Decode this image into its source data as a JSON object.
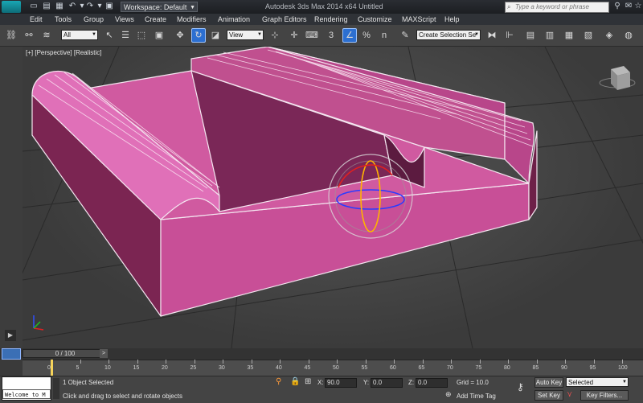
{
  "titlebar": {
    "workspace_label": "Workspace: Default",
    "window_title": "Autodesk 3ds Max  2014 x64   Untitled",
    "search_placeholder": "Type a keyword or phrase"
  },
  "menu": {
    "items": [
      "Edit",
      "Tools",
      "Group",
      "Views",
      "Create",
      "Modifiers",
      "Animation",
      "Graph Editors",
      "Rendering",
      "Customize",
      "MAXScript",
      "Help"
    ]
  },
  "toolbar": {
    "selection_filter": "All",
    "reference_coord": "View",
    "named_selection": "Create Selection Se",
    "snap_number": "3",
    "angle_snap_number": "n"
  },
  "viewport": {
    "label_plus": "[+]",
    "label_view": "[Perspective]",
    "label_shading": "[Realistic]",
    "object_color": "#cc5aa0"
  },
  "timeline": {
    "slider_text": "0 / 100",
    "ticks": [
      "0",
      "5",
      "10",
      "15",
      "20",
      "25",
      "30",
      "35",
      "40",
      "45",
      "50",
      "55",
      "60",
      "65",
      "70",
      "75",
      "80",
      "85",
      "90",
      "95",
      "100"
    ]
  },
  "status": {
    "objects_selected": "1 Object Selected",
    "prompt": "Click and drag to select and rotate objects",
    "maxscript_text": "Welcome to M",
    "x_label": "X:",
    "x_value": "90.0",
    "y_label": "Y:",
    "y_value": "0.0",
    "z_label": "Z:",
    "z_value": "0.0",
    "grid": "Grid = 10.0",
    "add_time_tag": "Add Time Tag",
    "auto_key": "Auto Key",
    "auto_key_mode": "Selected",
    "set_key": "Set Key",
    "key_filters": "Key Filters..."
  }
}
